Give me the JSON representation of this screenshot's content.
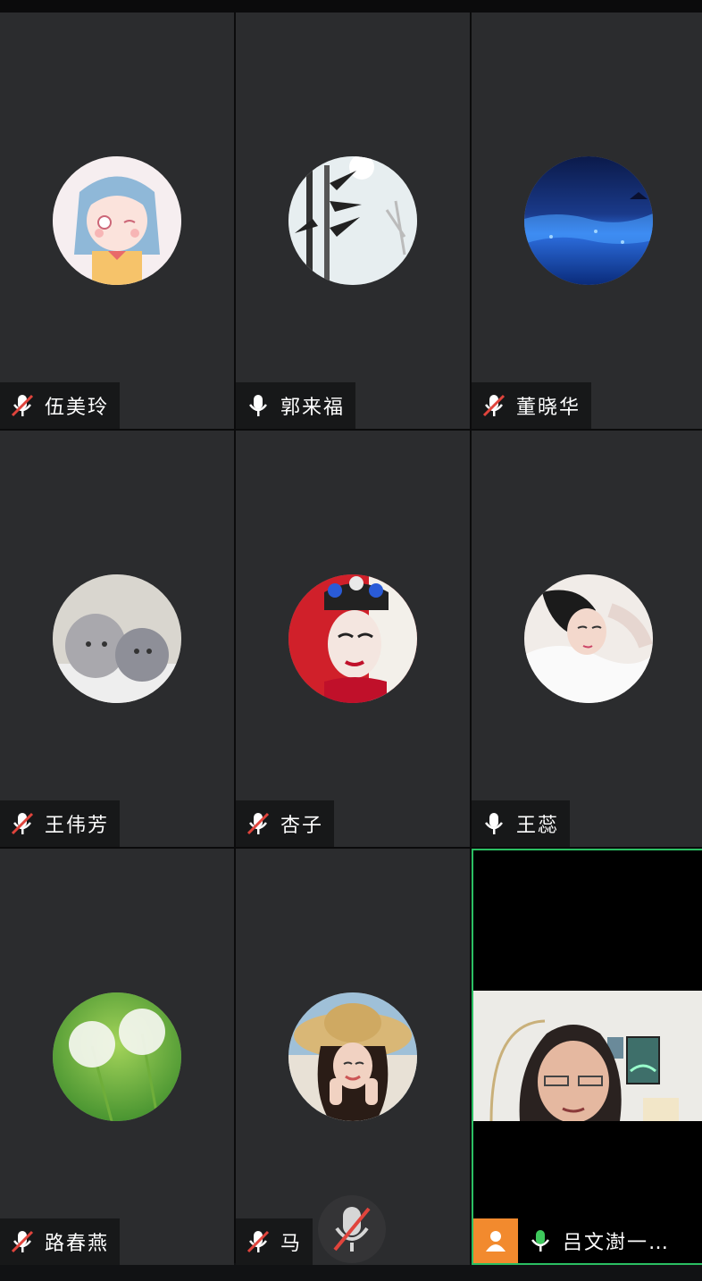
{
  "participants": [
    {
      "name": "伍美玲",
      "mic": "muted",
      "avatar": "cartoon-girl-avatar"
    },
    {
      "name": "郭来福",
      "mic": "on",
      "avatar": "bamboo-ink-avatar"
    },
    {
      "name": "董晓华",
      "mic": "muted",
      "avatar": "glowing-sea-avatar"
    },
    {
      "name": "王伟芳",
      "mic": "muted",
      "avatar": "kittens-avatar"
    },
    {
      "name": "杏子",
      "mic": "muted",
      "avatar": "opera-mask-avatar"
    },
    {
      "name": "王蕊",
      "mic": "on",
      "avatar": "woman-resting-avatar"
    },
    {
      "name": "路春燕",
      "mic": "muted",
      "avatar": "dandelion-avatar"
    },
    {
      "name": "马",
      "mic": "muted",
      "avatar": "straw-hat-woman-avatar"
    },
    {
      "name": "吕文澍一…",
      "mic": "on",
      "avatar": "live-video",
      "is_self": true
    }
  ],
  "colors": {
    "tile_bg": "#2b2c2e",
    "active_border": "#2bbf63",
    "mic_on_green": "#3ec95c",
    "muted_slash": "#e0443c",
    "self_badge": "#f28a2e"
  },
  "controls": {
    "main_mic_icon": "mic-muted-icon"
  }
}
